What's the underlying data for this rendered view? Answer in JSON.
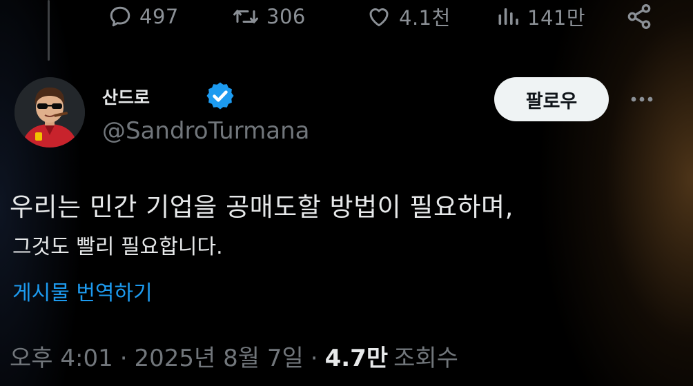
{
  "actions": {
    "replies": "497",
    "reposts": "306",
    "likes": "4.1천",
    "views": "141만"
  },
  "author": {
    "display_name": "산드로",
    "handle": "@SandroTurmana",
    "verified": true
  },
  "follow_label": "팔로우",
  "tweet": {
    "line1": "우리는 민간 기업을 공매도할 방법이 필요하며,",
    "line2": "그것도 빨리 필요합니다."
  },
  "translate_label": "게시물 번역하기",
  "meta": {
    "time": "오후 4:01",
    "separator": "·",
    "date": "2025년 8월 7일",
    "views_count": "4.7만",
    "views_label": "조회수"
  },
  "icons": [
    "reply-icon",
    "repost-icon",
    "like-icon",
    "views-icon",
    "share-icon",
    "verified-icon",
    "more-icon"
  ],
  "colors": {
    "background": "#000000",
    "text": "#e7e9ea",
    "muted": "#71767b",
    "accent": "#1d9bf0",
    "follow_bg": "#eff3f4"
  }
}
